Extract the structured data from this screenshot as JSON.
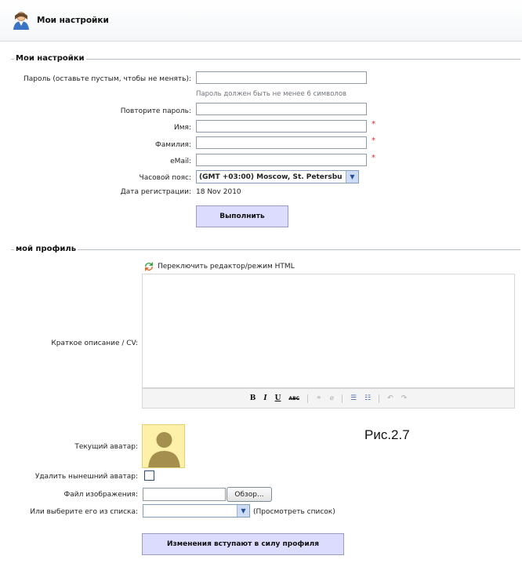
{
  "header": {
    "title": "Мои настройки",
    "icon": "user-settings-icon"
  },
  "settings": {
    "legend": "Мои настройки",
    "password_label": "Пароль (оставьте пустым, чтобы не менять):",
    "password_hint": "Пароль должен быть не менее 6 символов",
    "repeat_label": "Повторите пароль:",
    "firstname_label": "Имя:",
    "lastname_label": "Фамилия:",
    "email_label": "eMail:",
    "required_mark": "*",
    "timezone_label": "Часовой пояс:",
    "timezone_value": "(GMT +03:00) Moscow, St. Petersbu",
    "regdate_label": "Дата регистрации:",
    "regdate_value": "18 Nov 2010",
    "submit_label": "Выполнить"
  },
  "profile": {
    "legend": "мой профиль",
    "toggle_editor": "Переключить редактор/режим HTML",
    "cv_label": "Краткое описание / CV:",
    "toolbar": {
      "bold": "B",
      "italic": "I",
      "underline": "U",
      "strike": "ABC"
    },
    "avatar_label": "Текущий аватар:",
    "delete_avatar_label": "Удалить нынешний аватар:",
    "file_label": "Файл изображения:",
    "browse_label": "Обзор...",
    "choose_label": "Или выберите его из списка:",
    "view_list": "(Просмотреть список)",
    "apply_label": "Изменения вступают в силу профиля"
  },
  "figure_caption": "Рис.2.7"
}
